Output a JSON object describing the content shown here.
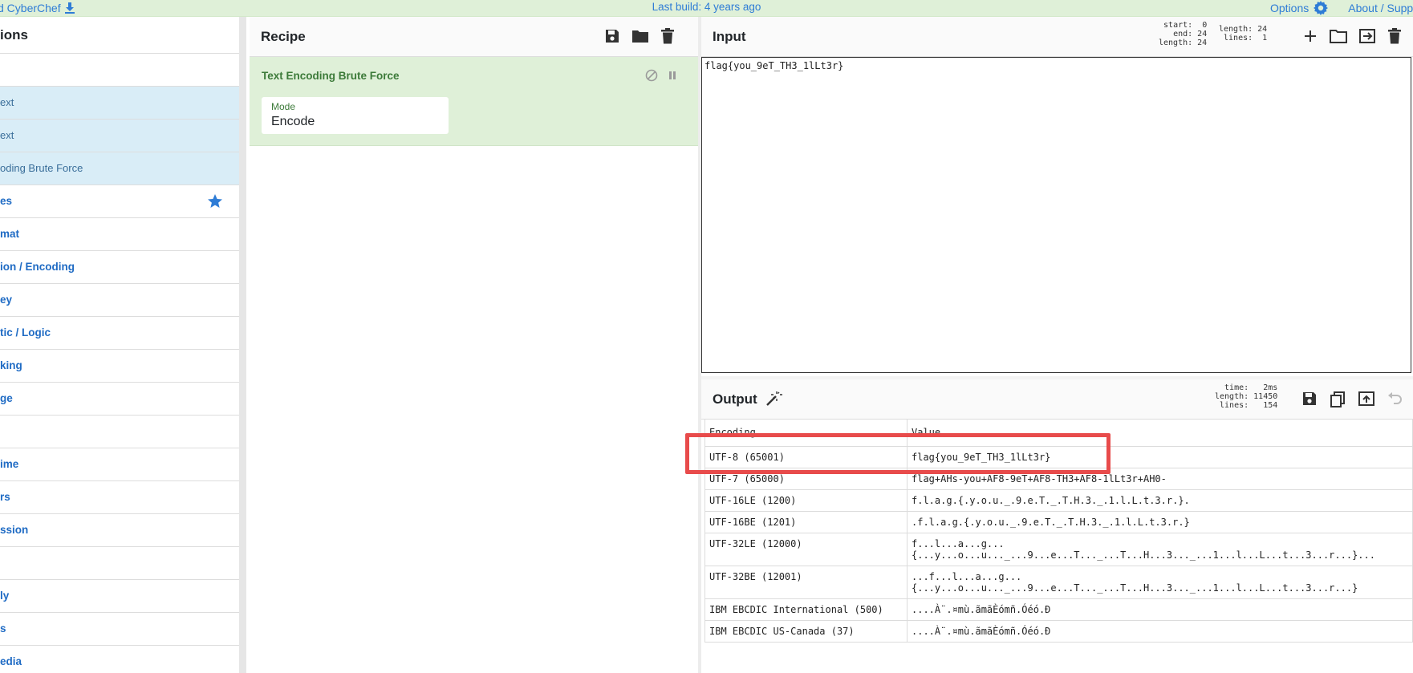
{
  "banner": {
    "app_label": "d CyberChef",
    "build": "Last build: 4 years ago",
    "options": "Options",
    "about": "About / Suppo"
  },
  "operations": {
    "title": "ions",
    "search_placeholder": "",
    "items": [
      {
        "label": "ext",
        "kind": "fav"
      },
      {
        "label": "ext",
        "kind": "fav"
      },
      {
        "label": "oding Brute Force",
        "kind": "fav"
      },
      {
        "label": "es",
        "kind": "cat",
        "star": true
      },
      {
        "label": "mat",
        "kind": "cat"
      },
      {
        "label": "ion / Encoding",
        "kind": "cat"
      },
      {
        "label": "ey",
        "kind": "cat"
      },
      {
        "label": "tic / Logic",
        "kind": "cat"
      },
      {
        "label": "king",
        "kind": "cat"
      },
      {
        "label": "ge",
        "kind": "cat"
      },
      {
        "label": "",
        "kind": "cat"
      },
      {
        "label": "ime",
        "kind": "cat"
      },
      {
        "label": "rs",
        "kind": "cat"
      },
      {
        "label": "ssion",
        "kind": "cat"
      },
      {
        "label": "",
        "kind": "cat"
      },
      {
        "label": "ly",
        "kind": "cat"
      },
      {
        "label": "s",
        "kind": "cat"
      },
      {
        "label": "edia",
        "kind": "cat"
      }
    ]
  },
  "recipe": {
    "title": "Recipe",
    "operation": {
      "name": "Text Encoding Brute Force",
      "mode_label": "Mode",
      "mode_value": "Encode"
    }
  },
  "input": {
    "title": "Input",
    "stats_left": "start:  0\n  end: 24\nlength: 24",
    "stats_right": "length: 24\n lines:  1",
    "value": "flag{you_9eT_TH3_1lLt3r}"
  },
  "output": {
    "title": "Output",
    "stats": "  time:   2ms\nlength: 11450\n lines:   154",
    "headers": {
      "encoding": "Encoding",
      "value": "Value"
    },
    "rows": [
      {
        "encoding": "UTF-8 (65001)",
        "value": "flag{you_9eT_TH3_1lLt3r}"
      },
      {
        "encoding": "UTF-7 (65000)",
        "value": "flag+AHs-you+AF8-9eT+AF8-TH3+AF8-1lLt3r+AH0-"
      },
      {
        "encoding": "UTF-16LE (1200)",
        "value": "f.l.a.g.{.y.o.u._.9.e.T._.T.H.3._.1.l.L.t.3.r.}."
      },
      {
        "encoding": "UTF-16BE (1201)",
        "value": ".f.l.a.g.{.y.o.u._.9.e.T._.T.H.3._.1.l.L.t.3.r.}"
      },
      {
        "encoding": "UTF-32LE (12000)",
        "value": "f...l...a...g...",
        "value2": "{...y...o...u..._...9...e...T..._...T...H...3..._...1...l...L...t...3...r...}..."
      },
      {
        "encoding": "UTF-32BE (12001)",
        "value": "...f...l...a...g...",
        "value2": "{...y...o...u..._...9...e...T..._...T...H...3..._...1...l...L...t...3...r...}"
      },
      {
        "encoding": "IBM EBCDIC International (500)",
        "value": "....À¨.¤mù.ãmãÈómñ.Óéó.Ð"
      },
      {
        "encoding": "IBM EBCDIC US-Canada (37)",
        "value": "....À¨.¤mù.ãmãÈómñ.Óéó.Ð"
      }
    ]
  },
  "colors": {
    "banner": "#dff0d8",
    "favourites": "#d9edf7",
    "category_text": "#1f6bc4",
    "operation_bg": "#dff0d8",
    "highlight": "#e84b4b"
  }
}
